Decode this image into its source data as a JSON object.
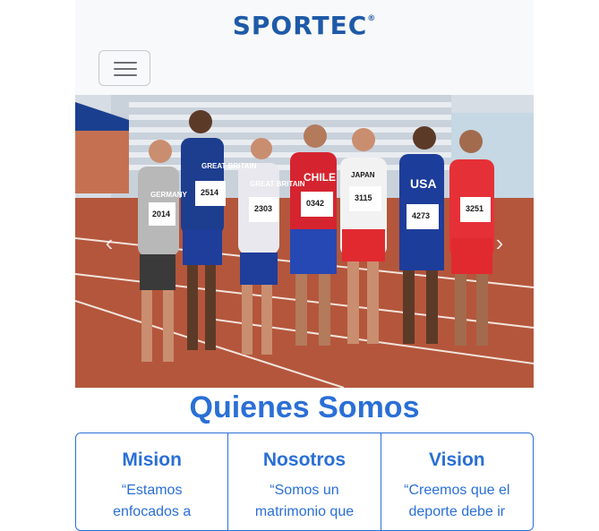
{
  "navbar": {
    "brand": "SPORTEC",
    "brand_mark": "®",
    "toggler_icon": "hamburger-icon"
  },
  "hero": {
    "image": "athletes-group-photo",
    "bibs": [
      "2014",
      "2514",
      "2303",
      "0342",
      "3115",
      "4273",
      "3251"
    ],
    "jersey_text": [
      "GERMANY",
      "GREAT BRITAIN",
      "GREAT BRITAIN",
      "CHILE",
      "JAPAN",
      "USA",
      ""
    ],
    "prev_icon": "chevron-left-icon",
    "next_icon": "chevron-right-icon"
  },
  "about": {
    "title": "Quienes Somos",
    "cards": [
      {
        "title": "Mision",
        "text": "“Estamos enfocados a"
      },
      {
        "title": "Nosotros",
        "text": "“Somos un matrimonio que"
      },
      {
        "title": "Vision",
        "text": "“Creemos que el deporte debe ir"
      }
    ]
  },
  "colors": {
    "brand": "#1e5aa8",
    "accent": "#2a6fd6",
    "navbar_bg": "#f8f9fa"
  }
}
